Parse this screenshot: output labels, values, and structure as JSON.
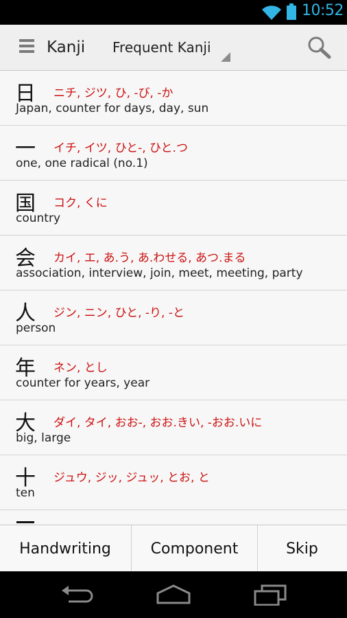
{
  "status_bar": {
    "time": "10:52",
    "icons": [
      "wifi-icon",
      "battery-icon"
    ],
    "accent_color": "#33b5e5"
  },
  "action_bar": {
    "title": "Kanji",
    "spinner_selected": "Frequent Kanji",
    "icons": [
      "menu-icon",
      "search-icon"
    ]
  },
  "list": {
    "reading_color": "#cc1111",
    "items": [
      {
        "kanji": "日",
        "readings": "ニチ, ジツ, ひ, -び, -か",
        "meaning": "Japan, counter for days, day, sun"
      },
      {
        "kanji": "一",
        "readings": "イチ, イツ, ひと-, ひと.つ",
        "meaning": "one, one radical (no.1)"
      },
      {
        "kanji": "国",
        "readings": "コク, くに",
        "meaning": "country"
      },
      {
        "kanji": "会",
        "readings": "カイ, エ, あ.う, あ.わせる, あつ.まる",
        "meaning": "association, interview, join, meet, meeting, party"
      },
      {
        "kanji": "人",
        "readings": "ジン, ニン, ひと, -り, -と",
        "meaning": "person"
      },
      {
        "kanji": "年",
        "readings": "ネン, とし",
        "meaning": "counter for years, year"
      },
      {
        "kanji": "大",
        "readings": "ダイ, タイ, おお-, おお.きい, -おお.いに",
        "meaning": "big, large"
      },
      {
        "kanji": "十",
        "readings": "ジュウ, ジッ, ジュッ, とお, と",
        "meaning": "ten"
      }
    ]
  },
  "bottom_tabs": {
    "handwriting": "Handwriting",
    "component": "Component",
    "skip": "Skip"
  },
  "nav_bar": {
    "icons": [
      "back-icon",
      "home-icon",
      "recent-apps-icon"
    ]
  }
}
